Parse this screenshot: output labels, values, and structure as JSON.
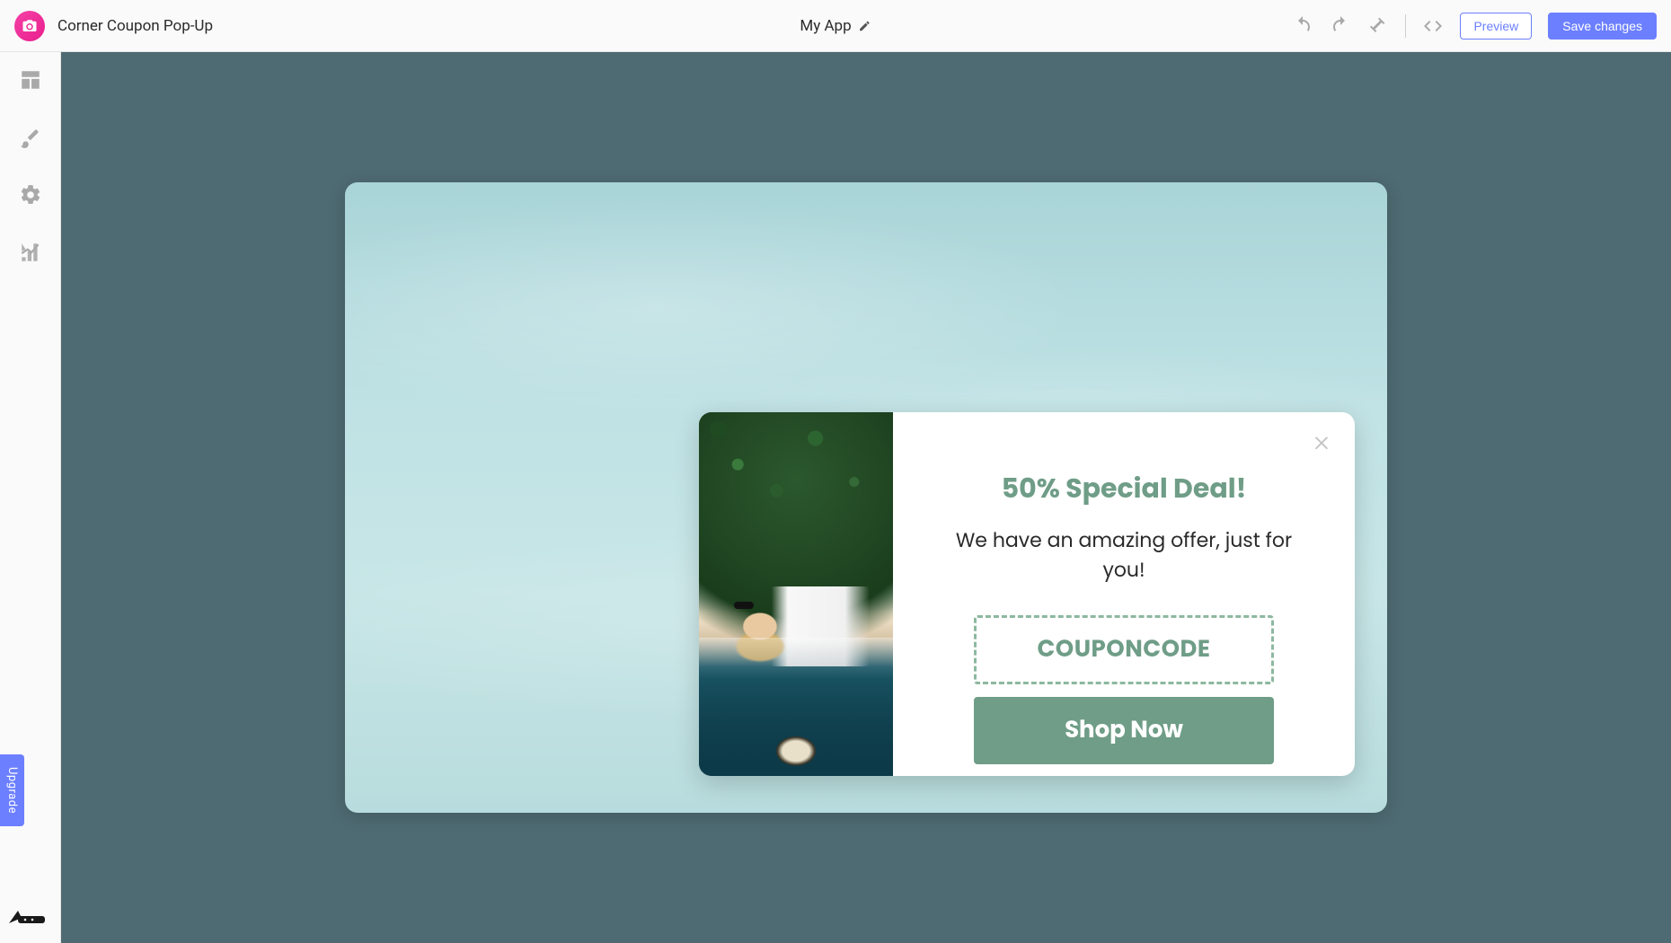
{
  "header": {
    "page_title": "Corner Coupon Pop-Up",
    "app_name": "My App",
    "preview_label": "Preview",
    "save_label": "Save changes"
  },
  "sidebar": {
    "upgrade_label": "Upgrade"
  },
  "popup": {
    "title": "50% Special Deal!",
    "subtitle": "We have an amazing offer, just for you!",
    "coupon_code": "COUPONCODE",
    "cta_label": "Shop Now"
  },
  "colors": {
    "accent": "#6b7fff",
    "popup_accent": "#6f9d87",
    "canvas_bg": "#4e6a72"
  }
}
